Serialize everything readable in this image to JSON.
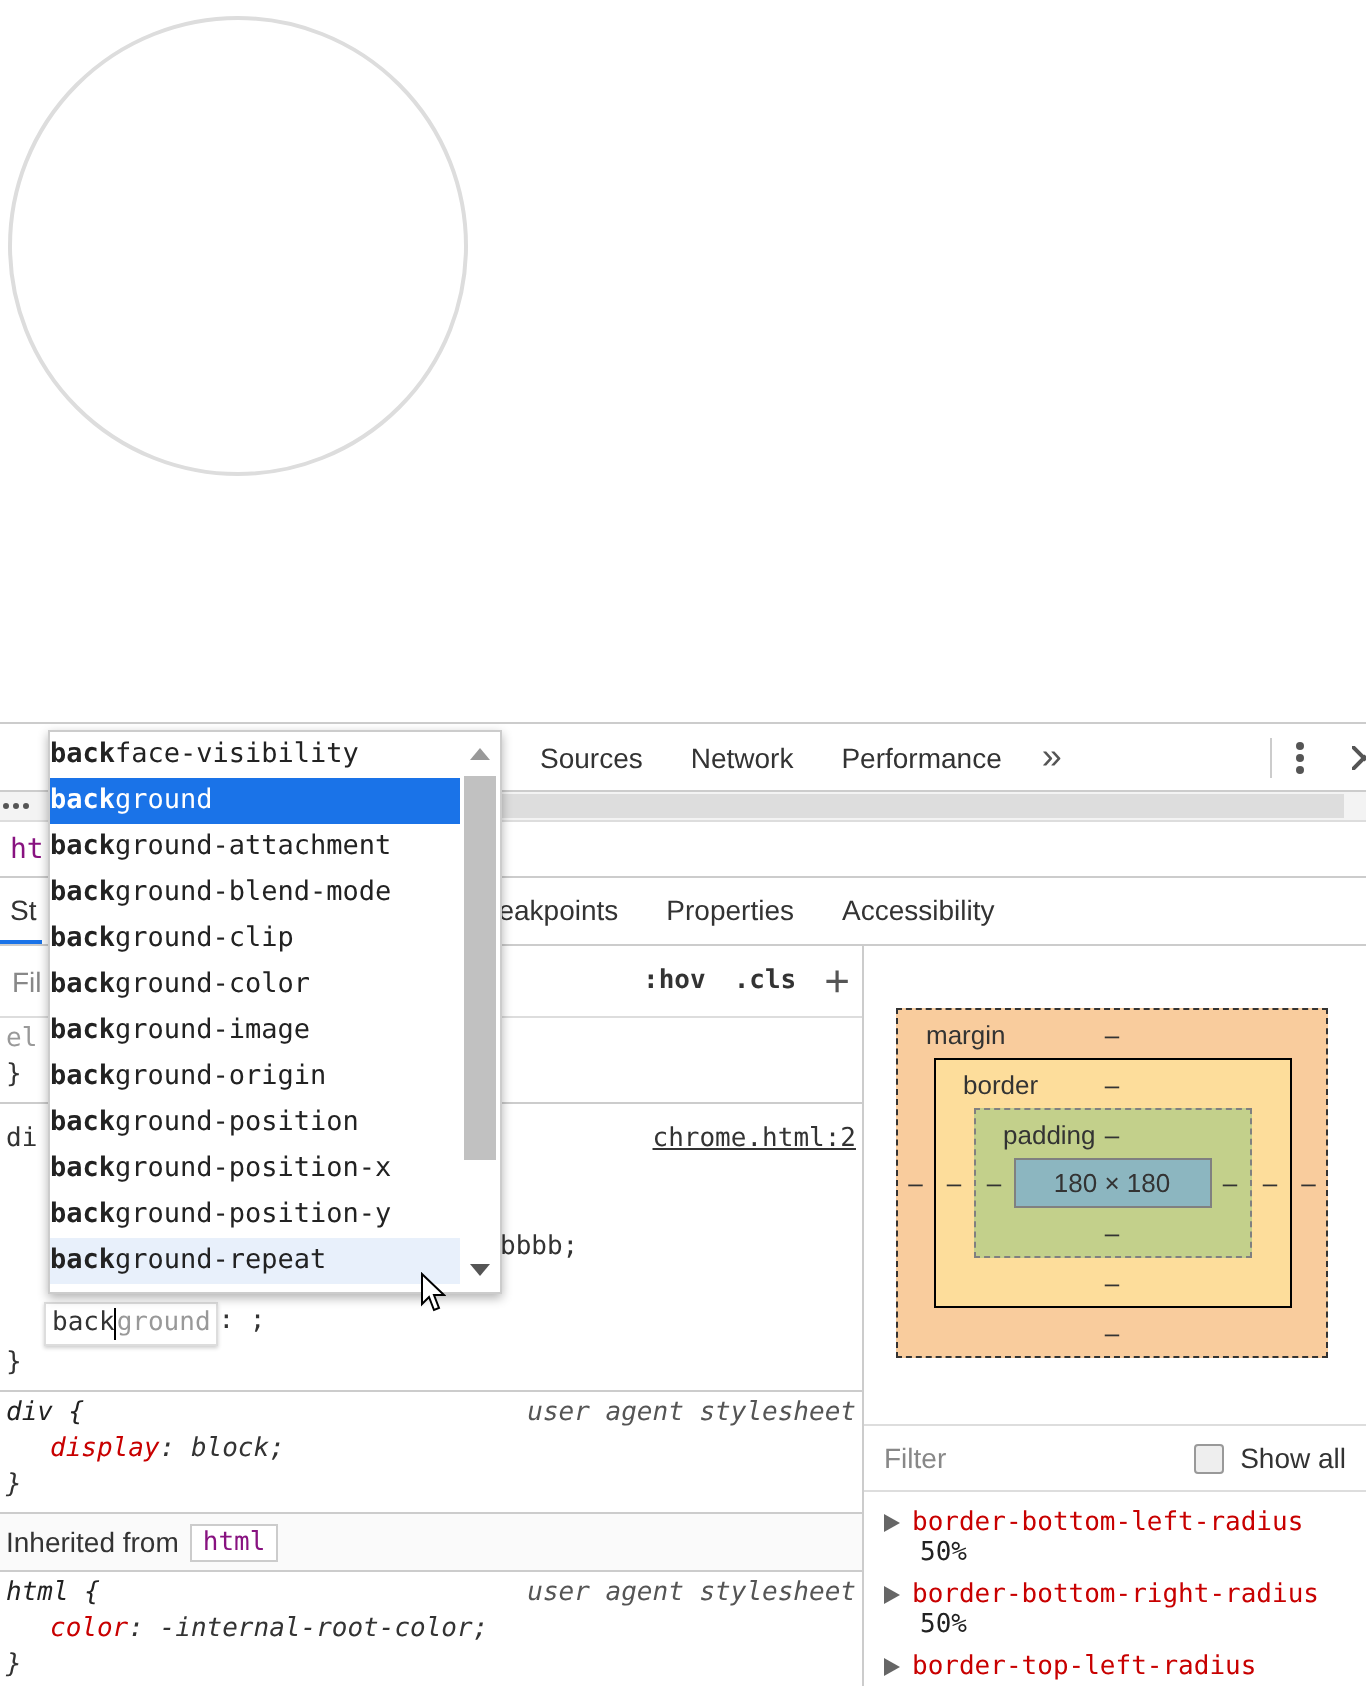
{
  "toolbar": {
    "tabs": [
      {
        "label": "Sources",
        "selected": false
      },
      {
        "label": "Network",
        "selected": false
      },
      {
        "label": "Performance",
        "selected": false
      }
    ],
    "more": "»"
  },
  "breadcrumb": "ht",
  "panel_tabs": [
    {
      "label": "St",
      "selected": true
    },
    {
      "label": "eakpoints",
      "selected": false
    },
    {
      "label": "Properties",
      "selected": false
    },
    {
      "label": "Accessibility",
      "selected": false
    }
  ],
  "styles": {
    "filter_placeholder": "Fil",
    "hov": ":hov",
    "cls": ".cls",
    "add": "+",
    "element_style": {
      "selector": "el",
      "close": "}"
    },
    "author_rule": {
      "selector": "di",
      "source": "chrome.html:2",
      "partial_value": "bbbb;",
      "editor": {
        "typed": "back",
        "suggestion": "ground",
        "rest": ": ;"
      },
      "close": "}"
    },
    "ua_rules": [
      {
        "selector": "div {",
        "source": "user agent stylesheet",
        "declarations": [
          {
            "name": "display",
            "punct": ":",
            "value": "block;"
          }
        ],
        "close": "}"
      }
    ],
    "inherited": {
      "label": "Inherited from",
      "element": "html"
    },
    "inherited_rules": [
      {
        "selector": "html {",
        "source": "user agent stylesheet",
        "declarations": [
          {
            "name": "color",
            "punct": ":",
            "value": "-internal-root-color;"
          }
        ],
        "close": "}"
      }
    ]
  },
  "autocomplete": {
    "items": [
      {
        "text": "**back**face-visibility",
        "selected": false,
        "hovered": false
      },
      {
        "text": "**back**ground",
        "selected": true,
        "hovered": false
      },
      {
        "text": "**back**ground-attachment",
        "selected": false,
        "hovered": false
      },
      {
        "text": "**back**ground-blend-mode",
        "selected": false,
        "hovered": false
      },
      {
        "text": "**back**ground-clip",
        "selected": false,
        "hovered": false
      },
      {
        "text": "**back**ground-color",
        "selected": false,
        "hovered": false
      },
      {
        "text": "**back**ground-image",
        "selected": false,
        "hovered": false
      },
      {
        "text": "**back**ground-origin",
        "selected": false,
        "hovered": false
      },
      {
        "text": "**back**ground-position",
        "selected": false,
        "hovered": false
      },
      {
        "text": "**back**ground-position-x",
        "selected": false,
        "hovered": false
      },
      {
        "text": "**back**ground-position-y",
        "selected": false,
        "hovered": false
      },
      {
        "text": "**back**ground-repeat",
        "selected": false,
        "hovered": true
      }
    ]
  },
  "box_model": {
    "margin": {
      "label": "margin",
      "top": "–",
      "right": "–",
      "bottom": "–",
      "left": "–"
    },
    "border": {
      "label": "border",
      "top": "–",
      "right": "–",
      "bottom": "–",
      "left": "–"
    },
    "padding": {
      "label": "padding",
      "top": "–",
      "right": "–",
      "bottom": "–",
      "left": "–"
    },
    "content": "180 × 180"
  },
  "computed": {
    "filter_placeholder": "Filter",
    "show_all": {
      "label": "Show all",
      "checked": false
    },
    "properties": [
      {
        "name": "border-bottom-left-radius",
        "value": "50%",
        "expanded": false
      },
      {
        "name": "border-bottom-right-radius",
        "value": "50%",
        "expanded": false
      },
      {
        "name": "border-top-left-radius",
        "expanded": false
      }
    ]
  }
}
